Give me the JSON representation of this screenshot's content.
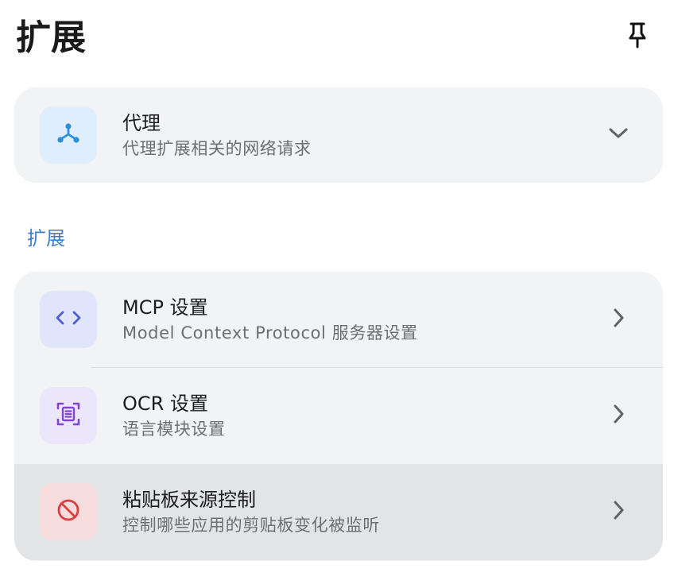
{
  "header": {
    "title": "扩展",
    "pin_icon": "pin-icon"
  },
  "proxy_card": {
    "title": "代理",
    "subtitle": "代理扩展相关的网络请求",
    "icon": "network-icon",
    "icon_color": "#2e8fd8",
    "icon_bg": "#deeefc",
    "expand_icon": "chevron-down-icon"
  },
  "section": {
    "label": "扩展",
    "label_color": "#3b7fd1"
  },
  "extensions": [
    {
      "title": "MCP 设置",
      "subtitle": "Model Context Protocol 服务器设置",
      "icon": "code-icon",
      "icon_color": "#4d5fd6",
      "icon_bg": "#e1e5fb"
    },
    {
      "title": "OCR 设置",
      "subtitle": "语言模块设置",
      "icon": "scan-text-icon",
      "icon_color": "#8145cf",
      "icon_bg": "#ece6fb"
    },
    {
      "title": "粘贴板来源控制",
      "subtitle": "控制哪些应用的剪贴板变化被监听",
      "icon": "block-icon",
      "icon_color": "#dc3f3f",
      "icon_bg": "#f6dcdc"
    }
  ]
}
